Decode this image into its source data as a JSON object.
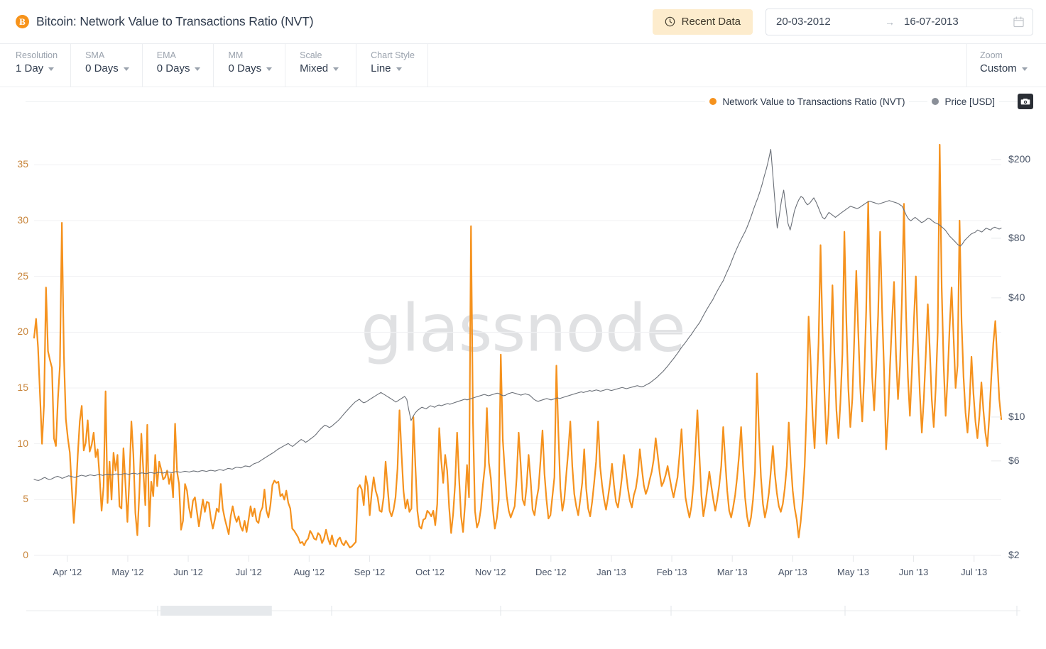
{
  "header": {
    "title": "Bitcoin: Network Value to Transactions Ratio (NVT)",
    "coin_symbol": "Ƀ",
    "recent_data_label": "Recent Data",
    "clock_icon": "clock-icon",
    "date_from": "20-03-2012",
    "date_to": "16-07-2013",
    "date_arrow": "→",
    "calendar_icon": "calendar-icon",
    "accent_color": "#f7931a",
    "recent_bg": "#fdeccd"
  },
  "toolbar": {
    "groups": [
      {
        "label": "Resolution",
        "value": "1 Day"
      },
      {
        "label": "SMA",
        "value": "0 Days"
      },
      {
        "label": "EMA",
        "value": "0 Days"
      },
      {
        "label": "MM",
        "value": "0 Days"
      },
      {
        "label": "Scale",
        "value": "Mixed"
      },
      {
        "label": "Chart Style",
        "value": "Line"
      }
    ],
    "zoom": {
      "label": "Zoom",
      "value": "Custom"
    }
  },
  "legend": {
    "items": [
      {
        "label": "Network Value to Transactions Ratio (NVT)",
        "color": "#f5921e"
      },
      {
        "label": "Price [USD]",
        "color": "#8a8f98"
      }
    ],
    "camera_icon": "camera-icon"
  },
  "watermark": "glassnode",
  "chart_data": {
    "type": "line",
    "title": "Bitcoin: Network Value to Transactions Ratio (NVT)",
    "xlabel": "",
    "grid": true,
    "legend_position": "top-right",
    "x_tick_labels": [
      "Apr '12",
      "May '12",
      "Jun '12",
      "Jul '12",
      "Aug '12",
      "Sep '12",
      "Oct '12",
      "Nov '12",
      "Dec '12",
      "Jan '13",
      "Feb '13",
      "Mar '13",
      "Apr '13",
      "May '13",
      "Jun '13",
      "Jul '13"
    ],
    "x_range": [
      "20-03-2012",
      "16-07-2013"
    ],
    "left_axis": {
      "label": "Network Value to Transactions Ratio (NVT)",
      "scale": "linear",
      "ylim": [
        0,
        37.5
      ],
      "ticks": [
        0,
        5,
        10,
        15,
        20,
        25,
        30,
        35
      ],
      "tick_labels": [
        "0",
        "5",
        "10",
        "15",
        "20",
        "25",
        "30",
        "35"
      ],
      "color": "#c8853b"
    },
    "right_axis": {
      "label": "Price [USD]",
      "scale": "log",
      "ylim": [
        2,
        260
      ],
      "ticks": [
        2,
        6,
        10,
        40,
        80,
        200
      ],
      "tick_labels": [
        "$2",
        "$6",
        "$10",
        "$40",
        "$80",
        "$200"
      ],
      "color": "#4a5568"
    },
    "series": [
      {
        "name": "Network Value to Transactions Ratio (NVT)",
        "color": "#f5921e",
        "axis": "left",
        "width": 2.2,
        "values": [
          19.5,
          21.2,
          18.6,
          14.3,
          10.0,
          13.5,
          24.0,
          18.3,
          17.5,
          16.8,
          10.5,
          9.8,
          14.0,
          17.0,
          29.8,
          18.0,
          12.2,
          10.5,
          9.2,
          6.0,
          2.9,
          5.5,
          9.0,
          12.0,
          13.4,
          9.4,
          10.1,
          12.1,
          9.3,
          9.9,
          11.0,
          8.8,
          9.5,
          7.0,
          4.0,
          6.2,
          14.7,
          4.7,
          8.4,
          5.0,
          9.2,
          7.6,
          9.0,
          4.4,
          4.2,
          9.6,
          6.4,
          3.0,
          6.9,
          12.0,
          9.0,
          3.8,
          1.8,
          5.6,
          10.9,
          7.6,
          4.5,
          11.7,
          2.6,
          6.6,
          5.3,
          9.0,
          6.2,
          8.4,
          7.7,
          6.8,
          7.0,
          7.6,
          6.4,
          7.3,
          5.2,
          11.8,
          7.5,
          6.4,
          2.3,
          3.1,
          6.4,
          5.8,
          4.3,
          3.4,
          4.9,
          5.2,
          3.9,
          2.6,
          3.8,
          5.0,
          3.9,
          4.8,
          4.7,
          3.3,
          2.4,
          3.2,
          4.2,
          3.9,
          6.4,
          4.2,
          3.3,
          2.6,
          1.9,
          3.5,
          4.4,
          3.5,
          3.0,
          3.5,
          2.6,
          2.2,
          3.1,
          2.1,
          3.2,
          4.4,
          3.5,
          4.2,
          3.1,
          2.9,
          3.9,
          4.3,
          5.9,
          4.0,
          3.4,
          4.5,
          6.3,
          6.7,
          6.5,
          6.6,
          5.3,
          5.5,
          5.0,
          5.8,
          4.7,
          4.2,
          2.4,
          2.2,
          1.9,
          1.6,
          1.1,
          1.2,
          0.9,
          1.3,
          1.5,
          2.2,
          1.9,
          1.5,
          1.4,
          2.0,
          1.8,
          1.1,
          1.5,
          2.3,
          1.5,
          1.0,
          1.8,
          1.0,
          0.8,
          1.4,
          1.6,
          1.1,
          0.9,
          1.3,
          1.0,
          0.7,
          0.8,
          1.0,
          1.2,
          6.0,
          6.3,
          5.9,
          4.5,
          7.1,
          6.2,
          3.6,
          5.6,
          7.0,
          5.8,
          5.2,
          4.0,
          3.9,
          5.2,
          8.4,
          6.1,
          4.0,
          3.5,
          4.1,
          5.2,
          7.8,
          13.0,
          9.2,
          5.8,
          4.2,
          5.0,
          3.9,
          4.2,
          12.4,
          8.0,
          4.0,
          2.6,
          2.4,
          3.2,
          3.3,
          4.0,
          3.8,
          3.5,
          4.0,
          2.7,
          4.6,
          11.4,
          8.5,
          6.5,
          9.0,
          7.6,
          4.3,
          2.0,
          3.7,
          6.4,
          11.0,
          6.9,
          3.5,
          2.1,
          4.6,
          8.1,
          5.2,
          29.5,
          12.0,
          4.0,
          2.5,
          3.0,
          4.2,
          6.3,
          8.0,
          13.2,
          8.3,
          6.9,
          4.1,
          2.4,
          3.3,
          5.0,
          18.0,
          10.4,
          7.6,
          5.3,
          4.0,
          3.4,
          3.9,
          4.4,
          7.0,
          11.0,
          8.2,
          5.0,
          4.5,
          6.2,
          9.0,
          6.8,
          4.1,
          3.6,
          5.0,
          6.0,
          8.5,
          11.2,
          7.3,
          5.0,
          3.3,
          3.6,
          5.3,
          7.0,
          17.0,
          11.0,
          6.0,
          4.0,
          5.0,
          7.3,
          9.4,
          12.0,
          8.0,
          5.5,
          4.4,
          3.6,
          5.0,
          6.5,
          9.5,
          6.0,
          4.2,
          3.5,
          4.8,
          6.5,
          8.4,
          12.0,
          8.0,
          6.3,
          5.0,
          4.1,
          5.2,
          6.5,
          8.2,
          6.3,
          4.8,
          4.3,
          5.5,
          7.0,
          9.0,
          7.5,
          6.0,
          4.9,
          4.3,
          5.4,
          6.0,
          7.2,
          9.5,
          7.8,
          6.3,
          5.5,
          6.0,
          6.8,
          7.5,
          8.6,
          10.5,
          9.0,
          7.4,
          6.2,
          6.6,
          7.2,
          8.0,
          7.0,
          6.0,
          5.2,
          6.1,
          7.0,
          9.0,
          11.3,
          7.8,
          5.2,
          4.2,
          3.4,
          4.4,
          6.4,
          9.5,
          13.0,
          9.0,
          5.4,
          3.5,
          4.6,
          6.0,
          7.5,
          6.2,
          5.0,
          4.0,
          5.0,
          6.3,
          8.0,
          11.5,
          8.5,
          5.8,
          4.0,
          3.4,
          4.3,
          5.4,
          7.0,
          9.0,
          11.5,
          8.0,
          5.2,
          3.5,
          2.6,
          3.4,
          5.0,
          7.5,
          16.3,
          11.0,
          7.0,
          4.6,
          3.4,
          4.3,
          5.6,
          7.6,
          9.8,
          7.3,
          5.6,
          4.4,
          3.9,
          4.6,
          6.0,
          8.0,
          11.9,
          8.4,
          5.8,
          4.2,
          3.2,
          1.6,
          3.0,
          5.0,
          8.0,
          13.2,
          21.4,
          17.4,
          12.5,
          9.6,
          14.3,
          19.0,
          27.8,
          20.0,
          14.5,
          10.0,
          12.6,
          18.0,
          24.2,
          18.0,
          13.0,
          10.5,
          13.7,
          18.0,
          29.0,
          21.0,
          15.0,
          11.5,
          14.0,
          19.5,
          25.5,
          20.0,
          15.0,
          12.0,
          16.0,
          22.0,
          31.7,
          22.0,
          16.0,
          13.0,
          17.0,
          21.5,
          29.0,
          22.0,
          16.5,
          9.5,
          12.5,
          17.0,
          21.0,
          24.5,
          18.0,
          14.0,
          17.0,
          23.0,
          31.5,
          22.0,
          16.0,
          12.5,
          16.5,
          21.0,
          25.0,
          19.0,
          14.5,
          11.0,
          14.0,
          18.0,
          22.5,
          18.5,
          14.0,
          11.5,
          15.0,
          20.0,
          36.8,
          24.0,
          17.0,
          12.5,
          16.0,
          20.5,
          24.0,
          19.5,
          15.0,
          17.0,
          30.0,
          21.0,
          16.0,
          12.8,
          11.0,
          13.5,
          17.8,
          14.5,
          12.0,
          10.5,
          12.5,
          15.5,
          13.0,
          11.0,
          9.8,
          12.5,
          16.0,
          19.0,
          21.0,
          17.5,
          14.0,
          12.2
        ]
      },
      {
        "name": "Price [USD]",
        "color": "#6b7078",
        "axis": "right",
        "width": 1.1,
        "values": [
          4.85,
          4.8,
          4.78,
          4.82,
          4.9,
          4.95,
          4.88,
          4.83,
          4.86,
          4.92,
          4.98,
          5.02,
          4.96,
          4.9,
          4.94,
          5.0,
          5.05,
          5.02,
          4.98,
          4.95,
          5.0,
          5.04,
          5.08,
          5.05,
          5.02,
          5.06,
          5.1,
          5.08,
          5.05,
          5.09,
          5.12,
          5.1,
          5.07,
          5.11,
          5.14,
          5.12,
          5.09,
          5.13,
          5.16,
          5.14,
          5.11,
          5.15,
          5.18,
          5.16,
          5.13,
          5.17,
          5.2,
          5.18,
          5.15,
          5.19,
          5.22,
          5.2,
          5.17,
          5.21,
          5.24,
          5.22,
          5.19,
          5.23,
          5.26,
          5.24,
          5.21,
          5.25,
          5.28,
          5.26,
          5.23,
          5.27,
          5.3,
          5.28,
          5.25,
          5.29,
          5.32,
          5.3,
          5.27,
          5.31,
          5.34,
          5.32,
          5.29,
          5.33,
          5.36,
          5.34,
          5.31,
          5.35,
          5.38,
          5.36,
          5.33,
          5.37,
          5.42,
          5.4,
          5.37,
          5.44,
          5.5,
          5.48,
          5.45,
          5.52,
          5.58,
          5.56,
          5.53,
          5.6,
          5.66,
          5.64,
          5.61,
          5.7,
          5.8,
          5.85,
          5.9,
          6.0,
          6.1,
          6.2,
          6.3,
          6.4,
          6.5,
          6.6,
          6.72,
          6.85,
          6.95,
          7.05,
          7.15,
          7.25,
          7.35,
          7.2,
          7.1,
          7.25,
          7.4,
          7.55,
          7.7,
          7.6,
          7.45,
          7.55,
          7.7,
          7.85,
          8.0,
          8.2,
          8.45,
          8.7,
          8.9,
          9.1,
          9.0,
          8.85,
          8.95,
          9.15,
          9.35,
          9.55,
          9.8,
          10.1,
          10.4,
          10.7,
          11.0,
          11.3,
          11.6,
          11.9,
          12.1,
          12.3,
          12.0,
          11.8,
          11.9,
          12.1,
          12.3,
          12.5,
          12.7,
          12.9,
          13.1,
          13.3,
          13.1,
          12.9,
          12.7,
          12.5,
          12.3,
          12.1,
          11.9,
          12.1,
          12.3,
          12.5,
          12.7,
          12.3,
          10.8,
          9.6,
          10.1,
          10.5,
          10.8,
          11.0,
          11.2,
          11.1,
          11.0,
          11.2,
          11.4,
          11.3,
          11.2,
          11.4,
          11.5,
          11.4,
          11.5,
          11.6,
          11.7,
          11.6,
          11.7,
          11.8,
          11.9,
          12.0,
          12.1,
          12.2,
          12.3,
          12.2,
          12.3,
          12.4,
          12.5,
          12.6,
          12.7,
          12.8,
          12.9,
          13.0,
          12.9,
          12.8,
          12.9,
          13.0,
          13.1,
          13.2,
          13.1,
          12.9,
          12.8,
          12.9,
          13.1,
          13.2,
          13.3,
          13.2,
          13.1,
          13.0,
          12.9,
          13.0,
          13.1,
          13.0,
          12.9,
          12.6,
          12.3,
          12.1,
          12.0,
          12.1,
          12.2,
          12.3,
          12.4,
          12.3,
          12.2,
          12.3,
          12.4,
          12.5,
          12.4,
          12.5,
          12.6,
          12.7,
          12.8,
          12.9,
          13.0,
          13.1,
          13.2,
          13.3,
          13.4,
          13.3,
          13.4,
          13.5,
          13.6,
          13.5,
          13.6,
          13.7,
          13.6,
          13.5,
          13.6,
          13.7,
          13.8,
          13.7,
          13.6,
          13.7,
          13.8,
          13.9,
          14.0,
          14.1,
          14.0,
          13.9,
          14.0,
          14.1,
          14.2,
          14.3,
          14.4,
          14.3,
          14.2,
          14.3,
          14.5,
          14.7,
          14.9,
          15.2,
          15.5,
          15.8,
          16.2,
          16.6,
          17.0,
          17.5,
          18.0,
          18.6,
          19.2,
          19.8,
          20.5,
          21.2,
          22.0,
          22.8,
          23.5,
          24.3,
          25.2,
          26.0,
          27.0,
          28.0,
          29.0,
          30.0,
          31.5,
          33.0,
          34.5,
          36.0,
          37.5,
          39.0,
          41.0,
          43.0,
          45.0,
          47.0,
          49.0,
          52.0,
          55.0,
          58.0,
          62.0,
          66.0,
          70.0,
          74.0,
          78.0,
          82.0,
          86.0,
          91.0,
          97.0,
          104.0,
          112.0,
          120.0,
          128.0,
          138.0,
          150.0,
          165.0,
          180.0,
          200.0,
          225.0,
          165.0,
          120.0,
          90.0,
          105.0,
          125.0,
          140.0,
          115.0,
          95.0,
          88.0,
          98.0,
          110.0,
          118.0,
          125.0,
          130.0,
          128.0,
          122.0,
          118.0,
          120.0,
          124.0,
          128.0,
          122.0,
          115.0,
          108.0,
          102.0,
          100.0,
          104.0,
          108.0,
          106.0,
          104.0,
          102.0,
          104.0,
          106.0,
          108.0,
          110.0,
          112.0,
          114.0,
          116.0,
          115.0,
          114.0,
          113.0,
          114.0,
          116.0,
          118.0,
          120.0,
          122.0,
          123.0,
          122.0,
          121.0,
          120.0,
          119.0,
          120.0,
          121.0,
          122.0,
          123.0,
          124.0,
          123.0,
          122.0,
          121.0,
          120.0,
          118.0,
          116.0,
          110.0,
          104.0,
          100.0,
          98.0,
          100.0,
          102.0,
          100.0,
          98.0,
          96.0,
          97.0,
          99.0,
          101.0,
          100.0,
          98.0,
          96.0,
          95.0,
          94.0,
          92.0,
          90.0,
          88.0,
          85.0,
          82.0,
          80.0,
          78.0,
          76.0,
          74.0,
          73.0,
          75.0,
          78.0,
          80.0,
          82.0,
          84.0,
          85.0,
          86.0,
          88.0,
          87.0,
          86.0,
          88.0,
          90.0,
          89.0,
          88.0,
          90.0,
          91.0,
          90.0,
          89.0,
          90.0
        ]
      }
    ]
  },
  "navigator": {
    "brush_start_pct": 13.5,
    "brush_end_pct": 24.7
  }
}
